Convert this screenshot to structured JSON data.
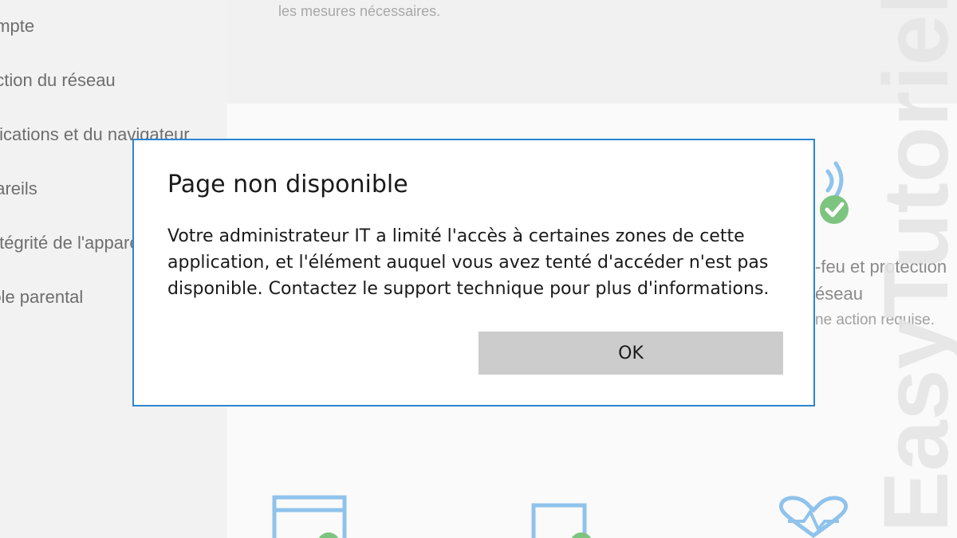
{
  "top_note": "les mesures nécessaires.",
  "sidebar": {
    "items": [
      {
        "label": "ompte"
      },
      {
        "label": "ection du réseau"
      },
      {
        "label": "plications et du navigateur"
      },
      {
        "label": "pareils"
      },
      {
        "label": " intégrité de l'appareil"
      },
      {
        "label": "rôle parental"
      }
    ]
  },
  "background_tile": {
    "title_line1": "-feu et protection",
    "title_line2": "éseau",
    "status": "ne action requise."
  },
  "dialog": {
    "title": "Page non disponible",
    "message": "Votre administrateur IT a limité l'accès à certaines zones de cette application, et l'élément auquel vous avez tenté d'accéder n'est pas disponible. Contactez le support technique pour plus d'informations.",
    "ok_label": "OK"
  },
  "watermark": {
    "text": "EasyTutoriel"
  },
  "colors": {
    "dialog_border": "#2c86d1",
    "button_bg": "#cccccc",
    "icon_blue": "#8fc3ec",
    "icon_green": "#7cc47f"
  }
}
